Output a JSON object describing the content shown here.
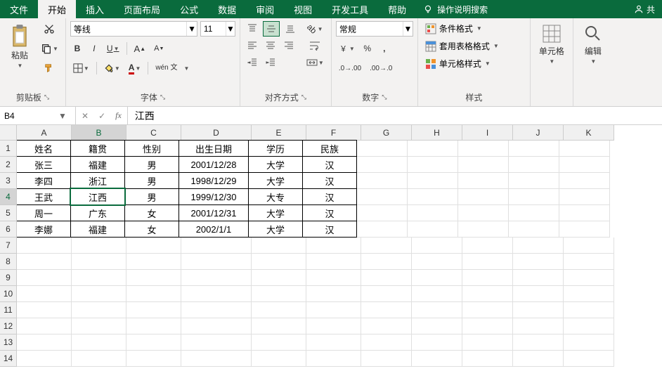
{
  "tabs": {
    "file": "文件",
    "home": "开始",
    "insert": "插入",
    "layout": "页面布局",
    "formulas": "公式",
    "data": "数据",
    "review": "审阅",
    "view": "视图",
    "dev": "开发工具",
    "help": "帮助",
    "tellme": "操作说明搜索",
    "share": "共"
  },
  "ribbon": {
    "clipboard": {
      "paste": "粘贴",
      "label": "剪贴板"
    },
    "font": {
      "name": "等线",
      "size": "11",
      "bold": "B",
      "italic": "I",
      "underline": "U",
      "ruby": "wén 文",
      "label": "字体"
    },
    "alignment": {
      "wrap": "ab",
      "merge_icon": "↔",
      "label": "对齐方式"
    },
    "number": {
      "format": "常规",
      "label": "数字"
    },
    "styles": {
      "conditional": "条件格式",
      "table": "套用表格格式",
      "cell": "单元格样式",
      "label": "样式"
    },
    "cells": {
      "label": "单元格"
    },
    "editing": {
      "label": "编辑"
    }
  },
  "formula_bar": {
    "name_box": "B4",
    "fx": "fx",
    "value": "江西"
  },
  "sheet": {
    "columns": [
      "A",
      "B",
      "C",
      "D",
      "E",
      "F",
      "G",
      "H",
      "I",
      "J",
      "K"
    ],
    "row_count": 14,
    "active_cell": {
      "col": "B",
      "row": 4
    },
    "headers": [
      "姓名",
      "籍贯",
      "性别",
      "出生日期",
      "学历",
      "民族"
    ],
    "rows": [
      {
        "name": "张三",
        "origin": "福建",
        "gender": "男",
        "dob": "2001/12/28",
        "edu": "大学",
        "ethnic": "汉"
      },
      {
        "name": "李四",
        "origin": "浙江",
        "gender": "男",
        "dob": "1998/12/29",
        "edu": "大学",
        "ethnic": "汉"
      },
      {
        "name": "王武",
        "origin": "江西",
        "gender": "男",
        "dob": "1999/12/30",
        "edu": "大专",
        "ethnic": "汉"
      },
      {
        "name": "周一",
        "origin": "广东",
        "gender": "女",
        "dob": "2001/12/31",
        "edu": "大学",
        "ethnic": "汉"
      },
      {
        "name": "李娜",
        "origin": "福建",
        "gender": "女",
        "dob": "2002/1/1",
        "edu": "大学",
        "ethnic": "汉"
      }
    ]
  }
}
